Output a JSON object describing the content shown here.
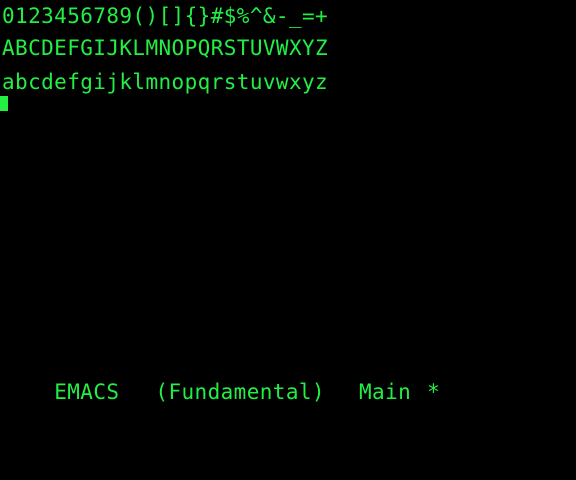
{
  "window": {
    "background": "#000000",
    "text_color": "#22ee44"
  },
  "buffer": {
    "lines": [
      "0123456789()[]{}#$%^&-_=+",
      "ABCDEFGIJKLMNOPQRSTUVWXYZ",
      "abcdefgijklmnopqrstuvwxyz"
    ],
    "cursor_line": 4
  },
  "modeline": {
    "editor": "EMACS",
    "mode": "(Fundamental)",
    "buffer_name": "Main",
    "modified_flag": "*"
  }
}
